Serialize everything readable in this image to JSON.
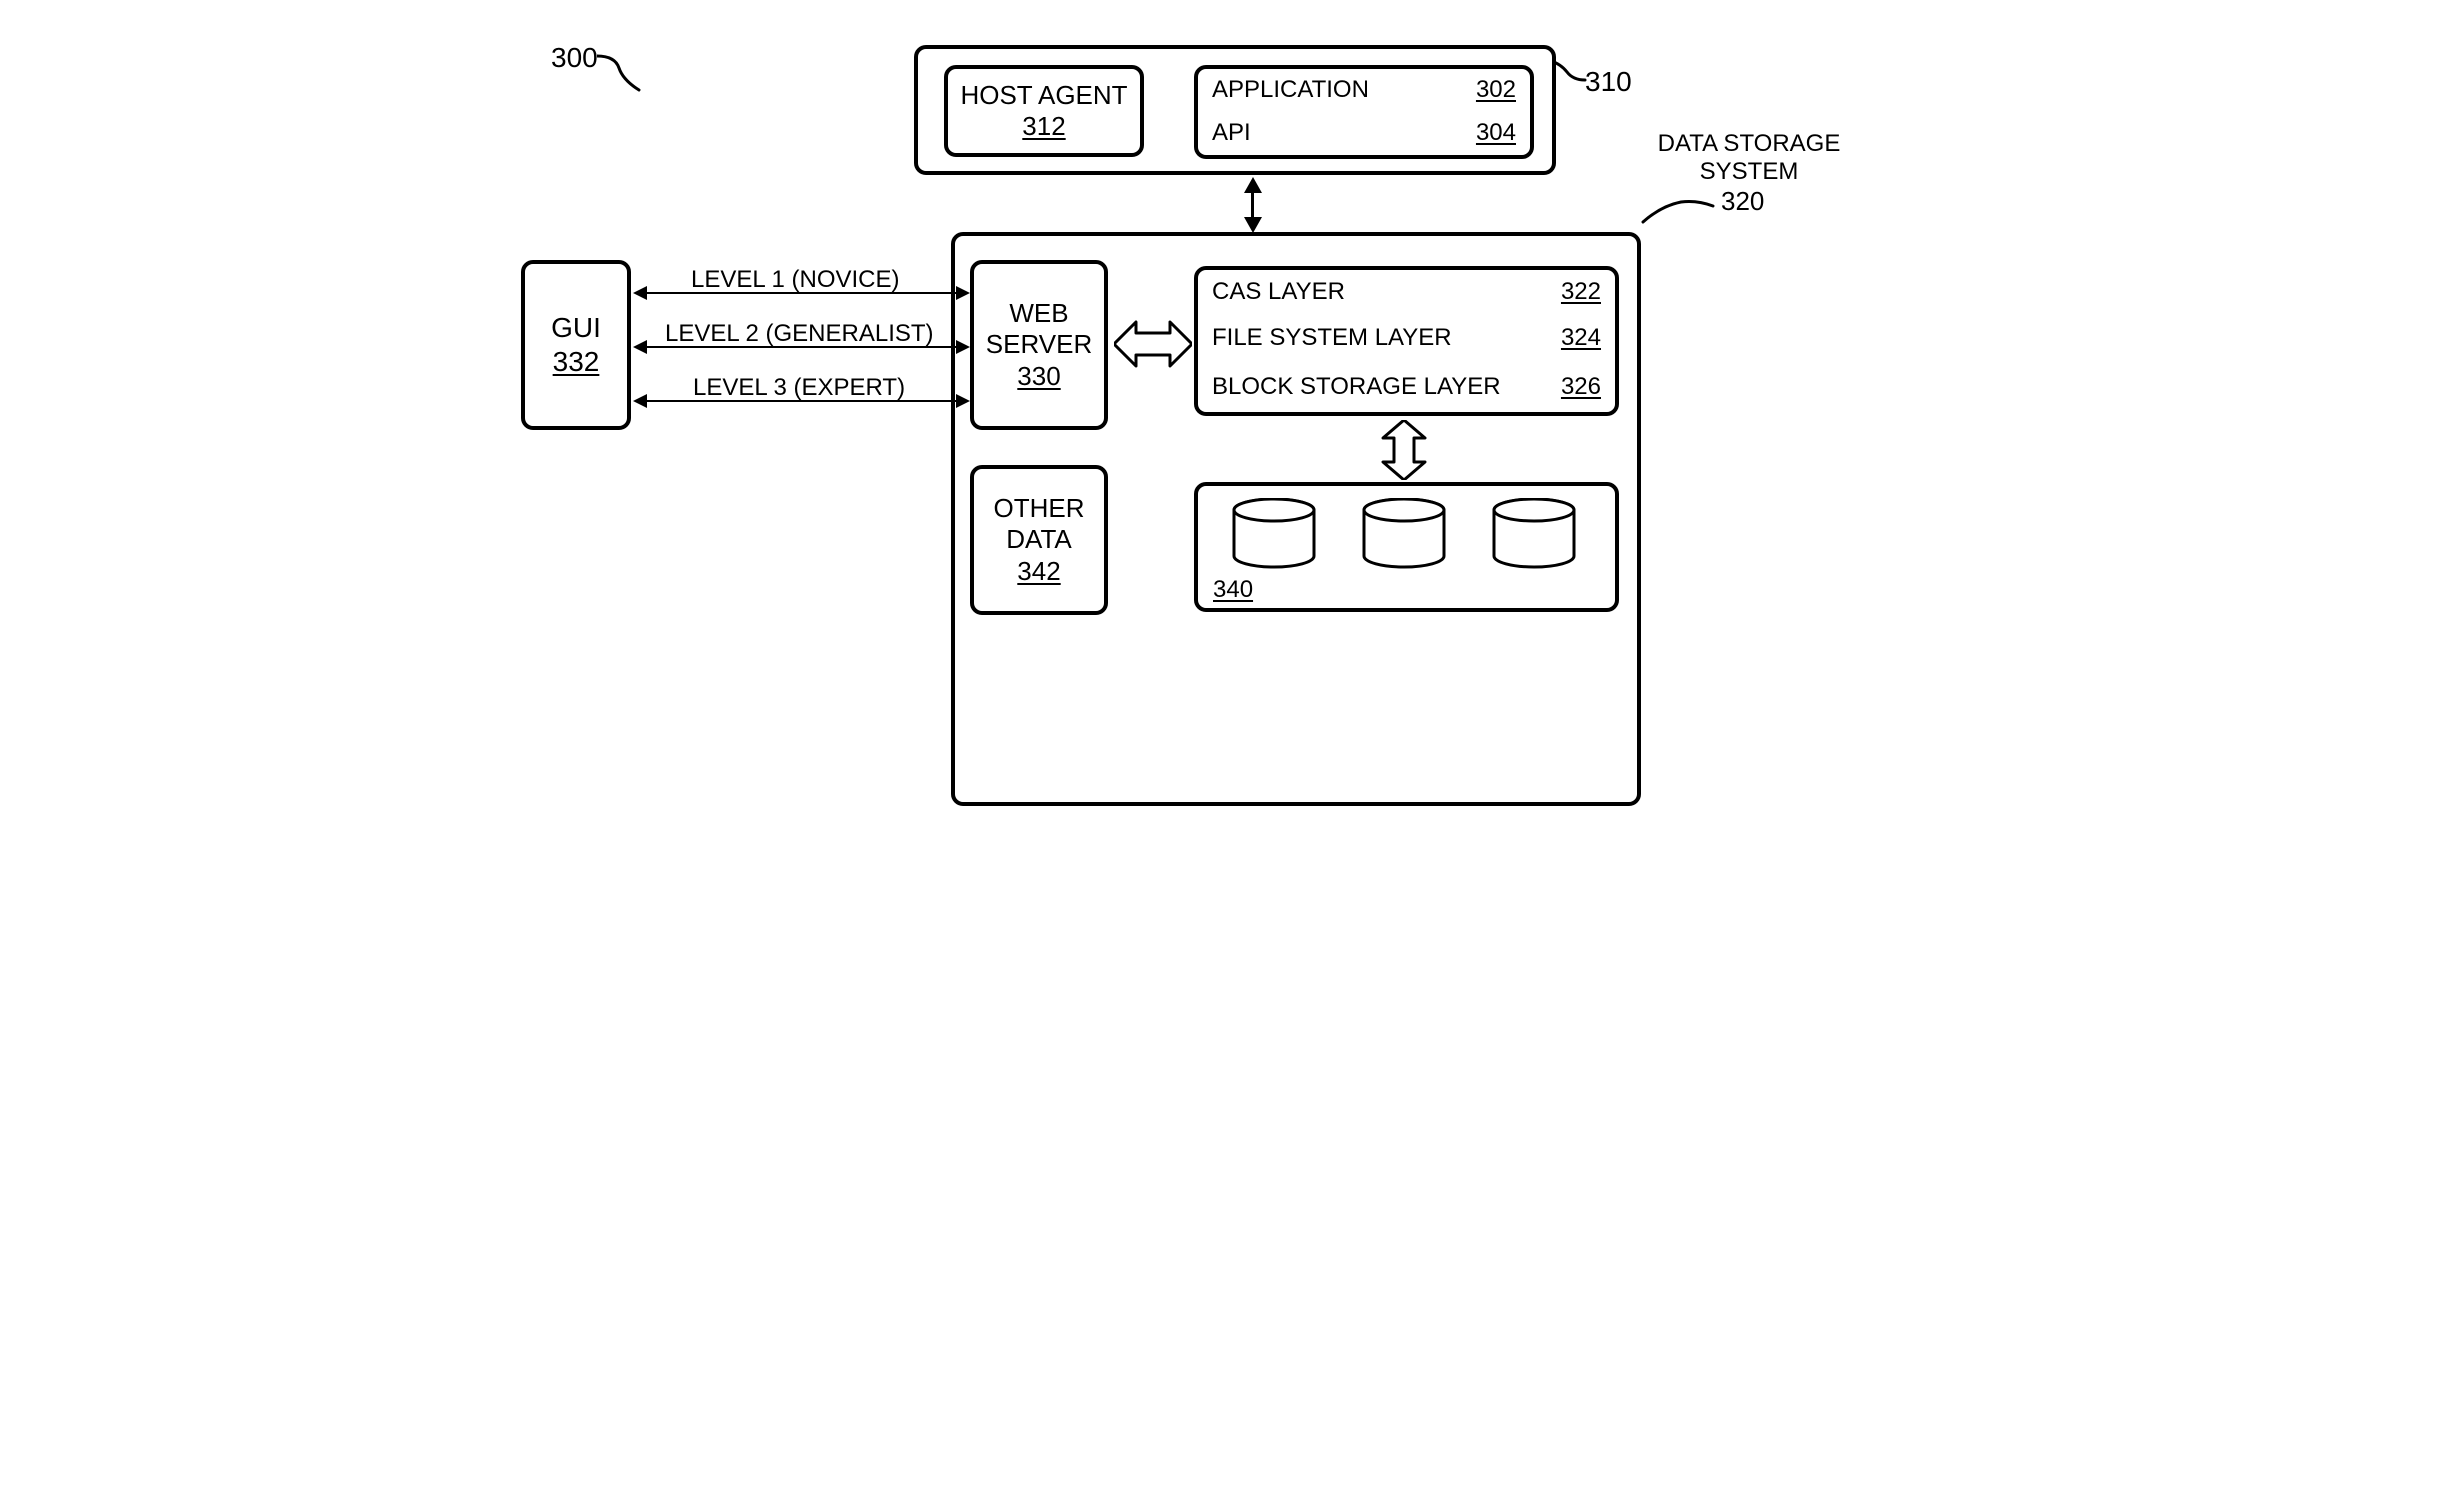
{
  "figureRef": "300",
  "hostRef": "310",
  "dataStorage": {
    "title": "DATA STORAGE\nSYSTEM",
    "ref": "320"
  },
  "hostContainer": {
    "hostAgent": {
      "label": "HOST AGENT",
      "ref": "312"
    },
    "app": {
      "label": "APPLICATION",
      "ref": "302"
    },
    "api": {
      "label": "API",
      "ref": "304"
    }
  },
  "gui": {
    "label": "GUI",
    "ref": "332"
  },
  "levels": {
    "l1": "LEVEL 1 (NOVICE)",
    "l2": "LEVEL 2 (GENERALIST)",
    "l3": "LEVEL 3 (EXPERT)"
  },
  "webServer": {
    "label": "WEB\nSERVER",
    "ref": "330"
  },
  "layers": {
    "cas": {
      "label": "CAS LAYER",
      "ref": "322"
    },
    "fs": {
      "label": "FILE SYSTEM LAYER",
      "ref": "324"
    },
    "blk": {
      "label": "BLOCK STORAGE LAYER",
      "ref": "326"
    }
  },
  "otherData": {
    "label": "OTHER\nDATA",
    "ref": "342"
  },
  "disks": {
    "ref": "340"
  }
}
